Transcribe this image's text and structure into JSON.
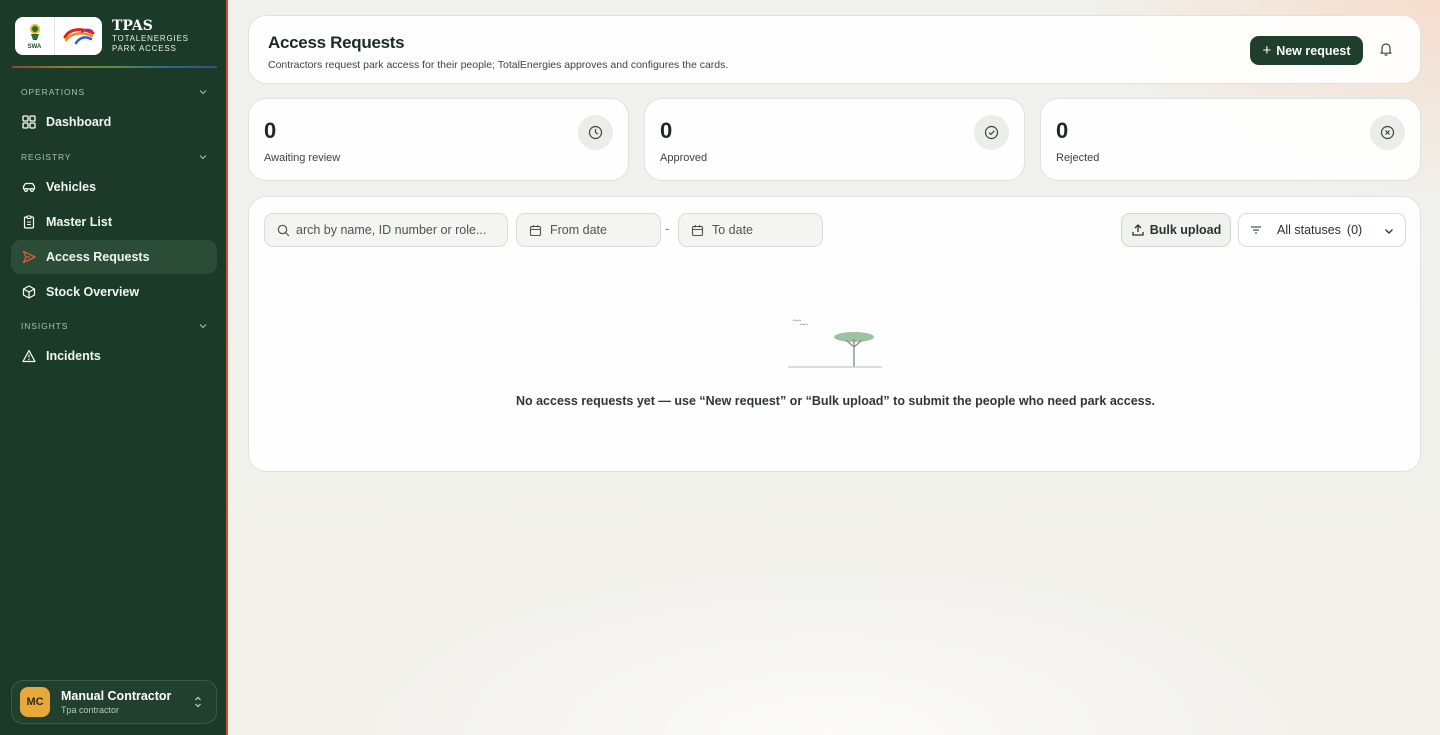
{
  "brand": {
    "logo_text": "SWA",
    "title": "TPAS",
    "subtitle_line1": "TOTALENERGIES",
    "subtitle_line2": "PARK ACCESS"
  },
  "sidebar": {
    "sections": [
      {
        "label": "OPERATIONS",
        "items": [
          {
            "label": "Dashboard",
            "icon": "grid-icon"
          }
        ]
      },
      {
        "label": "REGISTRY",
        "items": [
          {
            "label": "Vehicles",
            "icon": "car-icon"
          },
          {
            "label": "Master List",
            "icon": "clipboard-icon"
          },
          {
            "label": "Access Requests",
            "icon": "send-icon",
            "active": true
          },
          {
            "label": "Stock Overview",
            "icon": "box-icon"
          }
        ]
      },
      {
        "label": "INSIGHTS",
        "items": [
          {
            "label": "Incidents",
            "icon": "warning-icon"
          }
        ]
      }
    ],
    "user": {
      "initials": "MC",
      "name": "Manual Contractor",
      "role": "Tpa contractor"
    }
  },
  "header": {
    "title": "Access Requests",
    "subtitle": "Contractors request park access for their people; TotalEnergies approves and configures the cards.",
    "new_request_label": "New request"
  },
  "stats": [
    {
      "value": "0",
      "label": "Awaiting review",
      "icon": "clock-icon"
    },
    {
      "value": "0",
      "label": "Approved",
      "icon": "check-circle-icon"
    },
    {
      "value": "0",
      "label": "Rejected",
      "icon": "x-circle-icon"
    }
  ],
  "filters": {
    "search_text": "arch by name, ID number or role...",
    "from_date_placeholder": "From date",
    "separator": "-",
    "to_date_placeholder": "To date",
    "bulk_upload_label": "Bulk upload",
    "status_label": "All statuses",
    "status_count": "(0)"
  },
  "empty_state": {
    "message": "No access requests yet — use “New request” or “Bulk upload” to submit the people who need park access."
  },
  "colors": {
    "sidebar_bg": "#1c3a28",
    "active_item_bg": "#2b4d38",
    "primary_button": "#1f3e2c",
    "avatar_bg": "#e6a93a",
    "accent_edge": "#d9492a"
  }
}
